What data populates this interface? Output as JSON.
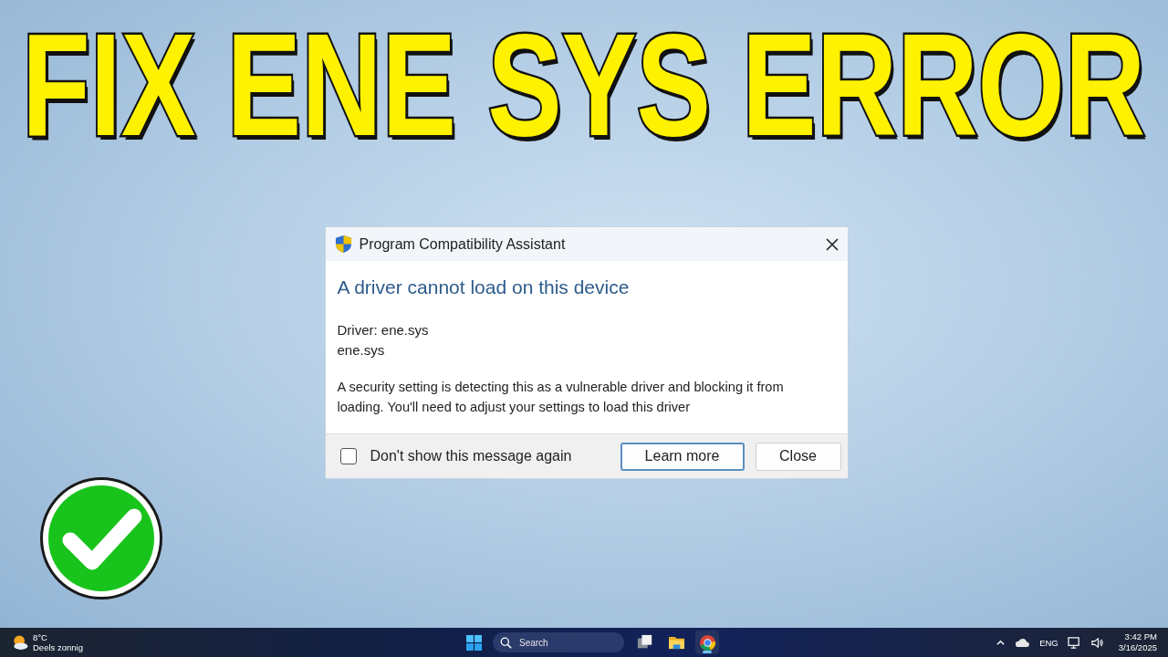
{
  "headline": "FIX ENE SYS ERROR",
  "dialog": {
    "title": "Program Compatibility Assistant",
    "heading": "A driver cannot load on this device",
    "details": [
      "Driver: ene.sys",
      "ene.sys"
    ],
    "message": "A security setting is detecting this as a vulnerable driver and blocking it from loading. You'll need to adjust your settings to load this driver",
    "checkbox": {
      "label": "Don't show this message again",
      "checked": false
    },
    "buttons": [
      {
        "label": "Learn more",
        "default": true
      },
      {
        "label": "Close",
        "default": false
      }
    ]
  },
  "taskbar": {
    "weather": {
      "temperature": "8°C",
      "condition": "Deels zonnig"
    },
    "search": {
      "placeholder": "Search"
    },
    "apps": [
      {
        "kind": "task-view",
        "active": false
      },
      {
        "kind": "folder",
        "active": false
      },
      {
        "kind": "browser",
        "active": true
      }
    ],
    "tray": {
      "language": "ENG",
      "time": "3:42 PM",
      "date": "3/16/2025"
    }
  }
}
